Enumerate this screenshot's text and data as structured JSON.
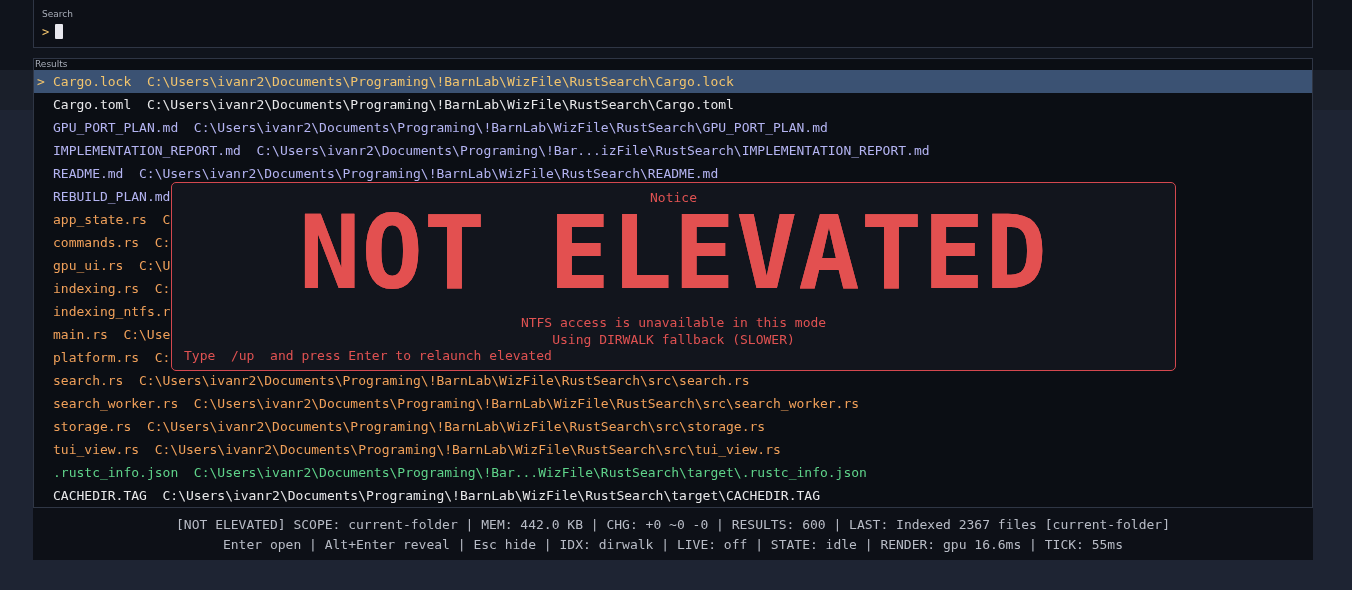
{
  "search": {
    "label": "Search",
    "prompt": ">"
  },
  "results": {
    "label": "Results",
    "selected_marker": ">",
    "rows": [
      {
        "name": "Cargo.lock",
        "path": "C:\\Users\\ivanr2\\Documents\\Programing\\!BarnLab\\WizFile\\RustSearch\\Cargo.lock",
        "color": "#f2c46d",
        "selected": true
      },
      {
        "name": "Cargo.toml",
        "path": "C:\\Users\\ivanr2\\Documents\\Programing\\!BarnLab\\WizFile\\RustSearch\\Cargo.toml",
        "color": "#e8e8ea",
        "selected": false
      },
      {
        "name": "GPU_PORT_PLAN.md",
        "path": "C:\\Users\\ivanr2\\Documents\\Programing\\!BarnLab\\WizFile\\RustSearch\\GPU_PORT_PLAN.md",
        "color": "#b4b4f2",
        "selected": false
      },
      {
        "name": "IMPLEMENTATION_REPORT.md",
        "path": "C:\\Users\\ivanr2\\Documents\\Programing\\!Bar...izFile\\RustSearch\\IMPLEMENTATION_REPORT.md",
        "color": "#b4b4f2",
        "selected": false
      },
      {
        "name": "README.md",
        "path": "C:\\Users\\ivanr2\\Documents\\Programing\\!BarnLab\\WizFile\\RustSearch\\README.md",
        "color": "#b4b4f2",
        "selected": false
      },
      {
        "name": "REBUILD_PLAN.md",
        "color": "#b4b4f2",
        "selected": false
      },
      {
        "name": "app_state.rs",
        "path": "C",
        "color": "#f0a05a",
        "selected": false
      },
      {
        "name": "commands.rs",
        "path": "C:",
        "color": "#f0a05a",
        "selected": false
      },
      {
        "name": "gpu_ui.rs",
        "path": "C:\\U",
        "color": "#f0a05a",
        "selected": false
      },
      {
        "name": "indexing.rs",
        "path": "C:",
        "color": "#f0a05a",
        "selected": false
      },
      {
        "name": "indexing_ntfs.r",
        "color": "#f0a05a",
        "selected": false
      },
      {
        "name": "main.rs",
        "path": "C:\\Use",
        "color": "#f0a05a",
        "selected": false
      },
      {
        "name": "platform.rs",
        "path": "C:",
        "color": "#f0a05a",
        "selected": false
      },
      {
        "name": "search.rs",
        "path": "C:\\Users\\ivanr2\\Documents\\Programing\\!BarnLab\\WizFile\\RustSearch\\src\\search.rs",
        "color": "#f0a05a",
        "selected": false
      },
      {
        "name": "search_worker.rs",
        "path": "C:\\Users\\ivanr2\\Documents\\Programing\\!BarnLab\\WizFile\\RustSearch\\src\\search_worker.rs",
        "color": "#f0a05a",
        "selected": false
      },
      {
        "name": "storage.rs",
        "path": "C:\\Users\\ivanr2\\Documents\\Programing\\!BarnLab\\WizFile\\RustSearch\\src\\storage.rs",
        "color": "#f0a05a",
        "selected": false
      },
      {
        "name": "tui_view.rs",
        "path": "C:\\Users\\ivanr2\\Documents\\Programing\\!BarnLab\\WizFile\\RustSearch\\src\\tui_view.rs",
        "color": "#f0a05a",
        "selected": false
      },
      {
        "name": ".rustc_info.json",
        "path": "C:\\Users\\ivanr2\\Documents\\Programing\\!Bar...WizFile\\RustSearch\\target\\.rustc_info.json",
        "color": "#5fd38a",
        "selected": false
      },
      {
        "name": "CACHEDIR.TAG",
        "path": "C:\\Users\\ivanr2\\Documents\\Programing\\!BarnLab\\WizFile\\RustSearch\\target\\CACHEDIR.TAG",
        "color": "#e8e8ea",
        "selected": false
      }
    ]
  },
  "notice": {
    "title": "Notice",
    "banner": "NOT ELEVATED",
    "lines": [
      "NTFS access is unavailable in this mode",
      "Using DIRWALK fallback (SLOWER)"
    ],
    "hint": "Type  /up  and press Enter to relaunch elevated"
  },
  "status_bar": [
    "[NOT ELEVATED] SCOPE: current-folder | MEM: 442.0 KB | CHG: +0 ~0 -0 | RESULTS: 600 | LAST: Indexed 2367 files [current-folder]",
    "Enter open | Alt+Enter reveal | Esc hide | IDX: dirwalk | LIVE: off | STATE: idle | RENDER: gpu 16.6ms | TICK: 55ms"
  ]
}
